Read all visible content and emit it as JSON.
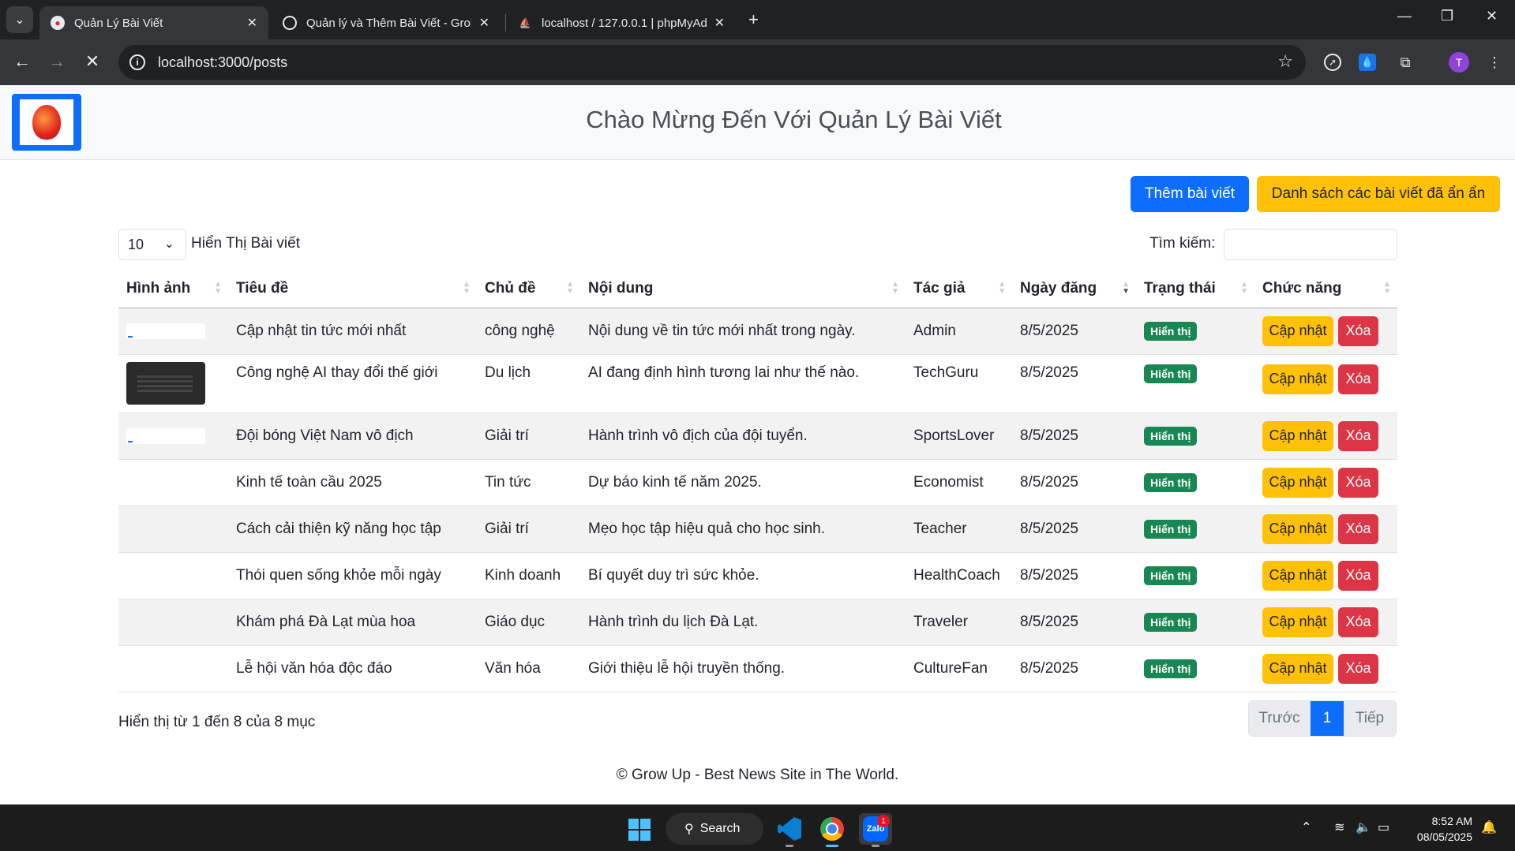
{
  "browser": {
    "tabs": [
      {
        "title": "Quản Lý Bài Viết",
        "active": true
      },
      {
        "title": "Quản lý và Thêm Bài Viết - Grok",
        "active": false
      },
      {
        "title": "localhost / 127.0.0.1 | phpMyAdmin",
        "active": false
      }
    ],
    "url": "localhost:3000/posts",
    "profile_initial": "T"
  },
  "header": {
    "title": "Chào Mừng Đến Với Quản Lý Bài Viết"
  },
  "actions": {
    "add_label": "Thêm bài viết",
    "hidden_list_label": "Danh sách các bài viết đã ẩn ẩn"
  },
  "table_controls": {
    "page_length": "10",
    "length_label": "Hiển Thị Bài viết",
    "search_label": "Tìm kiếm:",
    "search_value": ""
  },
  "table": {
    "columns": [
      "Hình ảnh",
      "Tiêu đề",
      "Chủ đề",
      "Nội dung",
      "Tác giả",
      "Ngày đăng",
      "Trạng thái",
      "Chức năng"
    ],
    "sorted_column": "Ngày đăng",
    "sort_direction": "desc",
    "update_label": "Cập nhật",
    "delete_label": "Xóa",
    "rows": [
      {
        "image": "blank",
        "title": "Cập nhật tin tức mới nhất",
        "topic": "công nghệ",
        "content": "Nội dung về tin tức mới nhất trong ngày.",
        "author": "Admin",
        "date": "8/5/2025",
        "status": "Hiển thị"
      },
      {
        "image": "screenshot",
        "title": "Công nghệ AI thay đổi thế giới",
        "topic": "Du lịch",
        "content": "AI đang định hình tương lai như thế nào.",
        "author": "TechGuru",
        "date": "8/5/2025",
        "status": "Hiển thị"
      },
      {
        "image": "blank",
        "title": "Đội bóng Việt Nam vô địch",
        "topic": "Giải trí",
        "content": "Hành trình vô địch của đội tuyển.",
        "author": "SportsLover",
        "date": "8/5/2025",
        "status": "Hiển thị"
      },
      {
        "image": "none",
        "title": "Kinh tế toàn cầu 2025",
        "topic": "Tin tức",
        "content": "Dự báo kinh tế năm 2025.",
        "author": "Economist",
        "date": "8/5/2025",
        "status": "Hiển thị"
      },
      {
        "image": "none",
        "title": "Cách cải thiện kỹ năng học tập",
        "topic": "Giải trí",
        "content": "Mẹo học tập hiệu quả cho học sinh.",
        "author": "Teacher",
        "date": "8/5/2025",
        "status": "Hiển thị"
      },
      {
        "image": "none",
        "title": "Thói quen sống khỏe mỗi ngày",
        "topic": "Kinh doanh",
        "content": "Bí quyết duy trì sức khỏe.",
        "author": "HealthCoach",
        "date": "8/5/2025",
        "status": "Hiển thị"
      },
      {
        "image": "none",
        "title": "Khám phá Đà Lạt mùa hoa",
        "topic": "Giáo dục",
        "content": "Hành trình du lịch Đà Lạt.",
        "author": "Traveler",
        "date": "8/5/2025",
        "status": "Hiển thị"
      },
      {
        "image": "none",
        "title": "Lễ hội văn hóa độc đáo",
        "topic": "Văn hóa",
        "content": "Giới thiệu lễ hội truyền thống.",
        "author": "CultureFan",
        "date": "8/5/2025",
        "status": "Hiển thị"
      }
    ]
  },
  "pagination": {
    "info": "Hiển thị từ 1 đến 8 của 8 mục",
    "prev_label": "Trước",
    "current_page": "1",
    "next_label": "Tiếp"
  },
  "footer": {
    "text": "© Grow Up - Best News Site in The World."
  },
  "taskbar": {
    "search_label": "Search",
    "zalo_badge": "1",
    "zalo_label": "Zalo",
    "time": "8:52 AM",
    "date": "08/05/2025"
  },
  "colors": {
    "primary": "#0d6efd",
    "warning": "#ffc107",
    "danger": "#dc3545",
    "success": "#198754"
  }
}
